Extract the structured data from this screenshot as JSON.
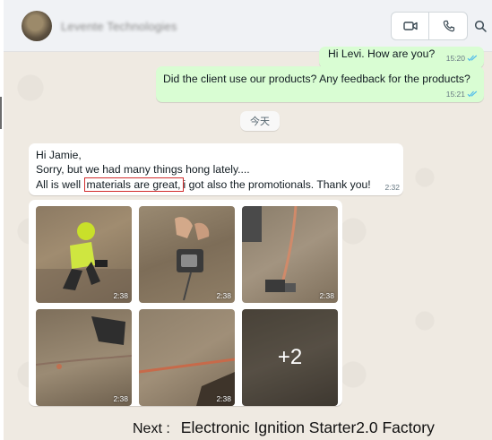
{
  "header": {
    "contact_name": "Levente Technologies",
    "icons": {
      "video": "video-call-icon",
      "voice": "voice-call-icon",
      "search": "search-icon"
    }
  },
  "messages": [
    {
      "direction": "out",
      "text": "Hi Levi. How are you?",
      "time": "15:20",
      "status": "read"
    },
    {
      "direction": "out",
      "text": "Did the client use our products? Any feedback for the products?",
      "time": "15:21",
      "status": "read"
    },
    {
      "direction": "in",
      "lines": [
        "Hi Jamie,",
        "Sorry, but we had many things hong lately....",
        "All is well",
        "materials are great,",
        "i got also the promotionals. Thank you!"
      ],
      "time": "2:32"
    }
  ],
  "date_separator": "今天",
  "media": {
    "thumbs": [
      {
        "time": "2:38"
      },
      {
        "time": "2:38"
      },
      {
        "time": "2:38"
      },
      {
        "time": "2:38"
      },
      {
        "time": "2:38"
      }
    ],
    "more": "+2"
  },
  "footer": {
    "label": "Next :",
    "text": "Electronic Ignition Starter2.0 Factory"
  },
  "colors": {
    "outgoing_bubble": "#d9fdd3",
    "incoming_bubble": "#ffffff",
    "chat_background": "#efeae2",
    "read_tick": "#53bdeb",
    "highlight_border": "#d22e2e"
  }
}
